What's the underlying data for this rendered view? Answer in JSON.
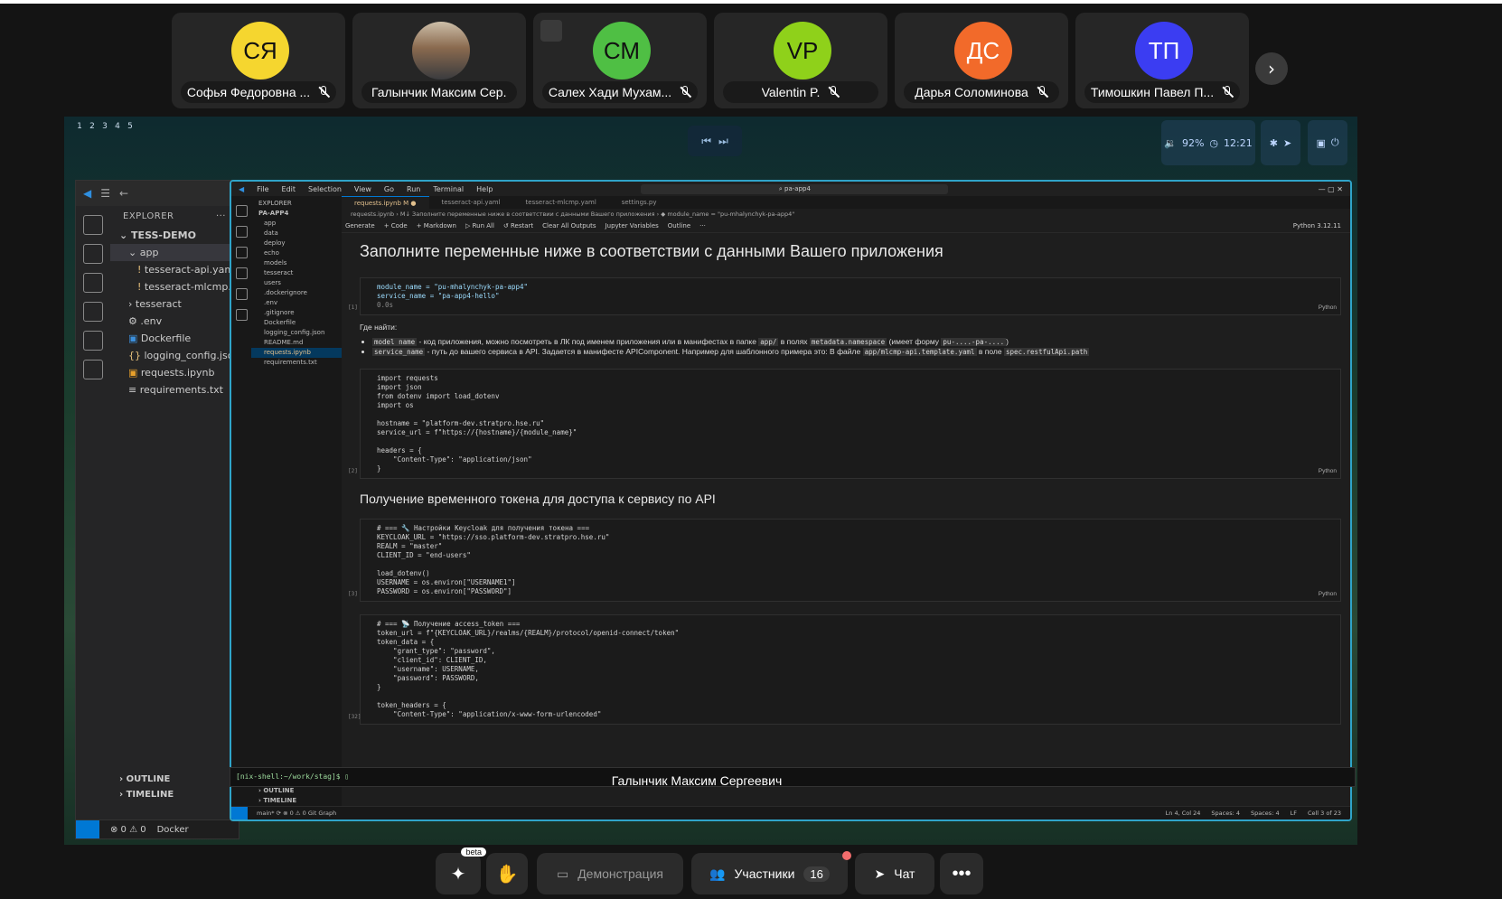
{
  "participants": [
    {
      "initials": "СЯ",
      "name": "Софья Федоровна ...",
      "color": "#f5d62f"
    },
    {
      "initials": "",
      "name": "Галынчик Максим Сер...",
      "color": "#888888",
      "photo": true
    },
    {
      "initials": "СМ",
      "name": "Салех Хади Мухам...",
      "color": "#4fbf44"
    },
    {
      "initials": "VP",
      "name": "Valentin P.",
      "color": "#8fd11a"
    },
    {
      "initials": "ДС",
      "name": "Дарья Соломинова",
      "color": "#f26a2a"
    },
    {
      "initials": "ТП",
      "name": "Тимошкин Павел П...",
      "color": "#3b3df2"
    }
  ],
  "tray": {
    "volume": "92%",
    "time": "12:21"
  },
  "workspaces": [
    "1",
    "2",
    "3",
    "4",
    "5"
  ],
  "small_vscode": {
    "explorer_title": "EXPLORER",
    "root": "TESS-DEMO",
    "items": [
      {
        "label": "app",
        "sel": true
      },
      {
        "label": "tesseract-api.yaml"
      },
      {
        "label": "tesseract-mlcmp...."
      },
      {
        "label": "tesseract"
      },
      {
        "label": ".env"
      },
      {
        "label": "Dockerfile"
      },
      {
        "label": "logging_config.json"
      },
      {
        "label": "requests.ipynb"
      },
      {
        "label": "requirements.txt"
      }
    ],
    "outline": "OUTLINE",
    "timeline": "TIMELINE",
    "status": "⊗ 0 ⚠ 0",
    "docker": "Docker"
  },
  "vscode": {
    "menu": [
      "File",
      "Edit",
      "Selection",
      "View",
      "Go",
      "Run",
      "Terminal",
      "Help"
    ],
    "search": "pa-app4",
    "explorer_title": "EXPLORER",
    "root": "PA-APP4",
    "files": [
      "app",
      "data",
      "deploy",
      "echo",
      "models",
      "tesseract",
      "users",
      ".dockerignore",
      ".env",
      ".gitignore",
      "Dockerfile",
      "logging_config.json",
      "README.md",
      "requests.ipynb",
      "requirements.txt"
    ],
    "outline": "OUTLINE",
    "timeline": "TIMELINE",
    "tabs": [
      "requests.ipynb M ●",
      "tesseract-api.yaml",
      "tesseract-mlcmp.yaml",
      "settings.py"
    ],
    "breadcrumb": "requests.ipynb › M↓ Заполните переменные ниже в соответствии с данными Вашего приложения › ◆ module_name = \"pu-mhalynchyk-pa-app4\"",
    "toolbar": [
      "Generate",
      "+ Code",
      "+ Markdown",
      "▷ Run All",
      "↺ Restart",
      "Clear All Outputs",
      "Jupyter Variables",
      "Outline",
      "···"
    ],
    "kernel": "Python 3.12.11",
    "heading1": "Заполните переменные ниже в соответствии с данными Вашего приложения",
    "cell1_line1": "module_name = \"pu-mhalynchyk-pa-app4\"",
    "cell1_line2": "service_name = \"pa-app4-hello\"",
    "cell1_time": "0.0s",
    "cell1_num": "[1]",
    "where_title": "Где найти:",
    "bullet1_code": "model name",
    "bullet1_text": " - код приложения, можно посмотреть в ЛК под именем приложения или в манифестах в папке ",
    "bullet1_code2": "app/",
    "bullet1_text2": " в полях ",
    "bullet1_code3": "metadata.namespace",
    "bullet1_text3": " (имеет форму ",
    "bullet1_code4": "pu-....-pa-....",
    "bullet1_text4": ")",
    "bullet2_code": "service_name",
    "bullet2_text": " - путь до вашего сервиса в API. Задается в манифесте APIComponent. Например для шаблонного примера это: В файле ",
    "bullet2_code2": "app/mlcmp-api.template.yaml",
    "bullet2_text2": " в поле ",
    "bullet2_code3": "spec.restfulApi.path",
    "cell2": "import requests\nimport json\nfrom dotenv import load_dotenv\nimport os\n\nhostname = \"platform-dev.stratpro.hse.ru\"\nservice_url = f\"https://{hostname}/{module_name}\"\n\nheaders = {\n    \"Content-Type\": \"application/json\"\n}",
    "cell2_num": "[2]",
    "heading2": "Получение временного токена для доступа к сервису по API",
    "cell3": "# === 🔧 Настройки Keycloak для получения токена ===\nKEYCLOAK_URL = \"https://sso.platform-dev.stratpro.hse.ru\"\nREALM = \"master\"\nCLIENT_ID = \"end-users\"\n\nload_dotenv()\nUSERNAME = os.environ[\"USERNAME1\"]\nPASSWORD = os.environ[\"PASSWORD\"]",
    "cell3_num": "[3]",
    "cell4": "# === 📡 Получение access_token ===\ntoken_url = f\"{KEYCLOAK_URL}/realms/{REALM}/protocol/openid-connect/token\"\ntoken_data = {\n    \"grant_type\": \"password\",\n    \"client_id\": CLIENT_ID,\n    \"username\": USERNAME,\n    \"password\": PASSWORD,\n}\n\ntoken_headers = {\n    \"Content-Type\": \"application/x-www-form-urlencoded\"",
    "cell4_num": "[32]",
    "lang": "Python",
    "status_left": "main* ⟳  ⊗ 0 ⚠ 0   Git Graph",
    "status_right": [
      "Ln 4, Col 24",
      "Spaces: 4",
      "Spaces: 4",
      "LF",
      "Cell 3 of 23"
    ]
  },
  "terminal": "[nix-shell:~/work/stag]$ ▯",
  "presenter": "Галынчик Максим Сергеевич",
  "bottom": {
    "beta": "beta",
    "demo": "Демонстрация",
    "participants": "Участники",
    "count": "16",
    "chat": "Чат"
  }
}
